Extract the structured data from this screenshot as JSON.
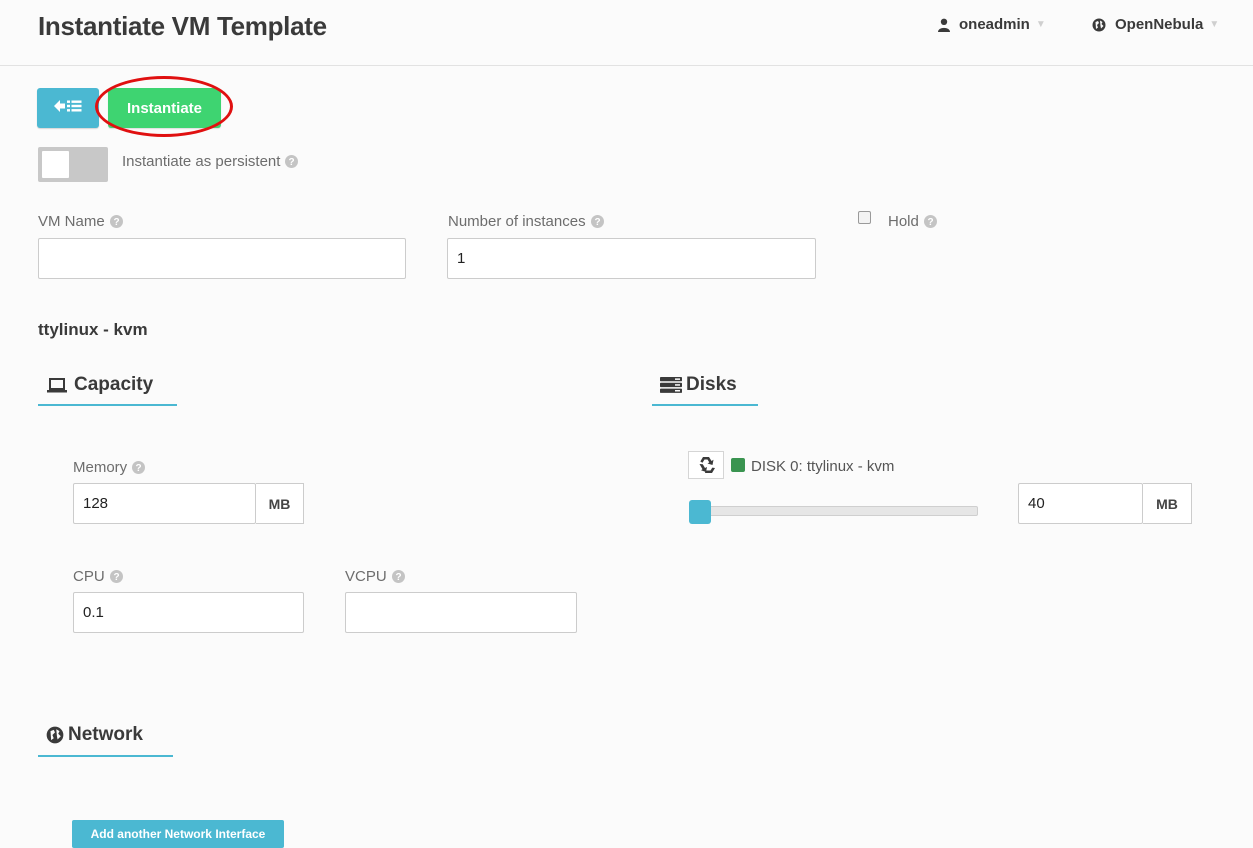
{
  "header": {
    "title": "Instantiate VM Template",
    "user": "oneadmin",
    "zone": "OpenNebula"
  },
  "actions": {
    "instantiate_label": "Instantiate"
  },
  "form": {
    "persistent_label": "Instantiate as persistent",
    "vm_name_label": "VM Name",
    "vm_name_value": "",
    "instances_label": "Number of instances",
    "instances_value": "1",
    "hold_label": "Hold"
  },
  "template": {
    "name": "ttylinux - kvm"
  },
  "capacity": {
    "title": "Capacity",
    "memory_label": "Memory",
    "memory_value": "128",
    "memory_unit": "MB",
    "cpu_label": "CPU",
    "cpu_value": "0.1",
    "vcpu_label": "VCPU",
    "vcpu_value": ""
  },
  "disks": {
    "title": "Disks",
    "disk_label": "DISK 0: ttylinux - kvm",
    "size_value": "40",
    "size_unit": "MB",
    "slider_level": 0
  },
  "network": {
    "title": "Network",
    "add_button_label": "Add another Network Interface"
  },
  "colors": {
    "accent": "#4bb8d2",
    "instantiate": "#3ed471",
    "highlight": "#e01010",
    "disk_status": "#3a9450"
  }
}
